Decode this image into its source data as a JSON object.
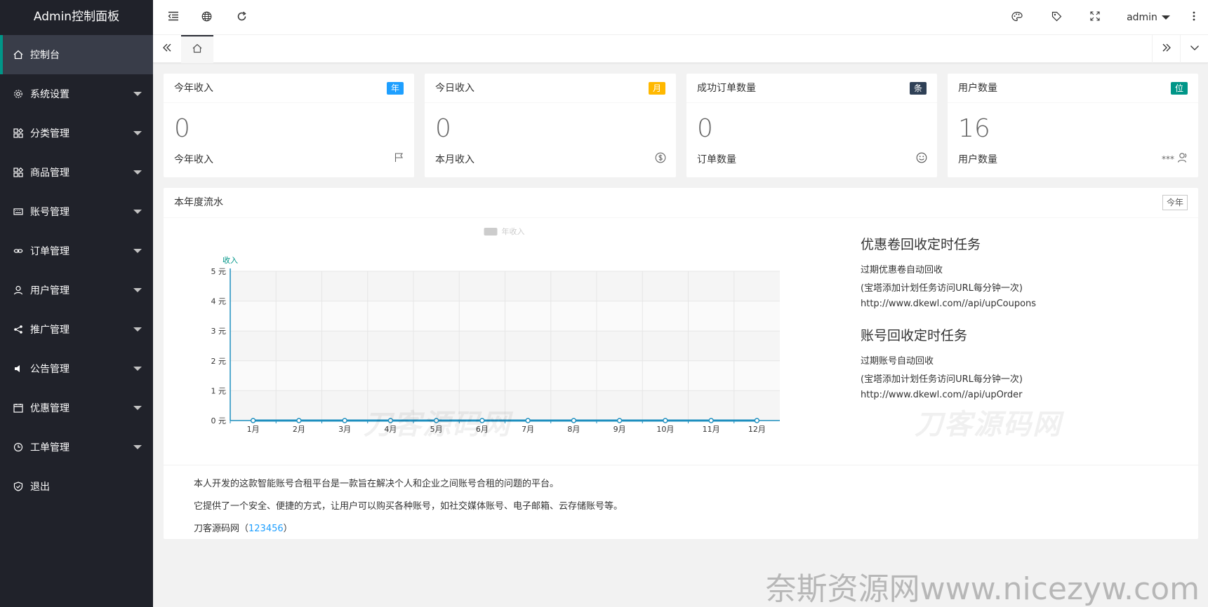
{
  "sidebar": {
    "brand": "Admin控制面板",
    "items": [
      {
        "label": "控制台",
        "icon": "home-icon"
      },
      {
        "label": "系统设置",
        "icon": "gear-icon"
      },
      {
        "label": "分类管理",
        "icon": "apps-icon"
      },
      {
        "label": "商品管理",
        "icon": "apps-icon"
      },
      {
        "label": "账号管理",
        "icon": "keyboard-icon"
      },
      {
        "label": "订单管理",
        "icon": "link-icon"
      },
      {
        "label": "用户管理",
        "icon": "user-icon"
      },
      {
        "label": "推广管理",
        "icon": "share-icon"
      },
      {
        "label": "公告管理",
        "icon": "speaker-icon"
      },
      {
        "label": "优惠管理",
        "icon": "calendar-icon"
      },
      {
        "label": "工单管理",
        "icon": "clock-icon"
      },
      {
        "label": "退出",
        "icon": "shield-icon"
      }
    ]
  },
  "header": {
    "user": "admin",
    "icons": [
      "shrink-menu-icon",
      "globe-icon",
      "refresh-icon",
      "theme-icon",
      "tag-icon",
      "fullscreen-icon",
      "more-icon"
    ]
  },
  "stats": [
    {
      "title": "今年收入",
      "badge": "年",
      "badge_color": "#1e9fff",
      "value": "0",
      "footer": "今年收入",
      "icon": "flag-icon",
      "extra": ""
    },
    {
      "title": "今日收入",
      "badge": "月",
      "badge_color": "#ffb800",
      "value": "0",
      "footer": "本月收入",
      "icon": "dollar-icon",
      "extra": ""
    },
    {
      "title": "成功订单数量",
      "badge": "条",
      "badge_color": "#2f4056",
      "value": "0",
      "footer": "订单数量",
      "icon": "smile-icon",
      "extra": ""
    },
    {
      "title": "用户数量",
      "badge": "位",
      "badge_color": "#009688",
      "value": "16",
      "footer": "用户数量",
      "icon": "users-icon",
      "extra": "***"
    }
  ],
  "panel": {
    "title": "本年度流水",
    "year_button": "今年"
  },
  "chart_data": {
    "type": "line",
    "categories": [
      "1月",
      "2月",
      "3月",
      "4月",
      "5月",
      "6月",
      "7月",
      "8月",
      "9月",
      "10月",
      "11月",
      "12月"
    ],
    "series": [
      {
        "name": "年收入",
        "values": [
          0,
          0,
          0,
          0,
          0,
          0,
          0,
          0,
          0,
          0,
          0,
          0
        ]
      }
    ],
    "ylabel": "收入",
    "ylim": [
      0,
      5
    ],
    "yticks": [
      "0 元",
      "1 元",
      "2 元",
      "3 元",
      "4 元",
      "5 元"
    ],
    "legend": "top",
    "grid": true,
    "color": "#1e8fbf"
  },
  "tasks": [
    {
      "title": "优惠卷回收定时任务",
      "lines": [
        "过期优惠卷自动回收",
        "(宝塔添加计划任务访问URL每分钟一次)",
        "http://www.dkewl.com//api/upCoupons"
      ]
    },
    {
      "title": "账号回收定时任务",
      "lines": [
        "过期账号自动回收",
        "(宝塔添加计划任务访问URL每分钟一次)",
        "http://www.dkewl.com//api/upOrder"
      ]
    }
  ],
  "description": {
    "line1": "本人开发的这款智能账号合租平台是一款旨在解决个人和企业之间账号合租的问题的平台。",
    "line2": "它提供了一个安全、便捷的方式，让用户可以购买各种账号，如社交媒体账号、电子邮箱、云存储账号等。",
    "line3_prefix": "刀客源码网（",
    "line3_link": "123456",
    "line3_suffix": "）"
  },
  "watermarks": {
    "chart": "刀客源码网",
    "right": "刀客源码网",
    "corner": "奈斯资源网www.nicezyw.com"
  }
}
